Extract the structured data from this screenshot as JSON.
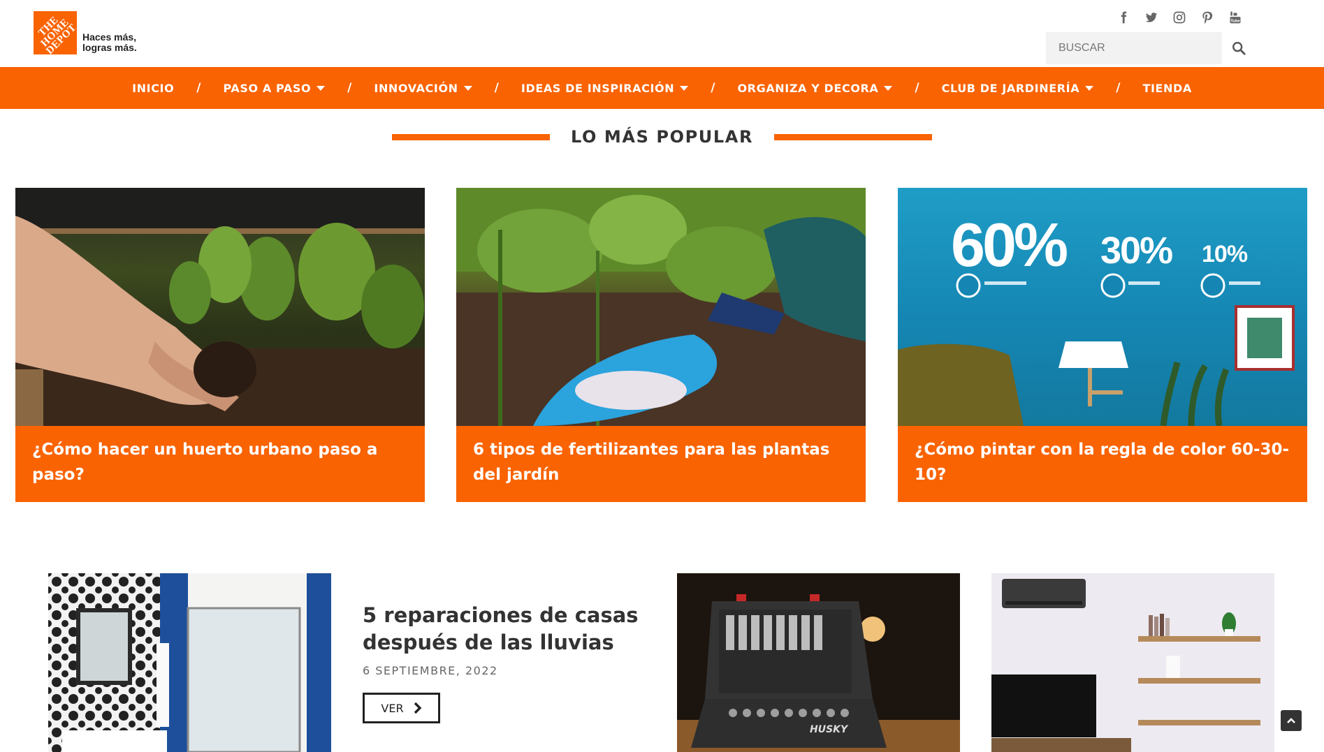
{
  "header": {
    "logo_text": "THE\nHOME\nDEPOT",
    "tagline_line1": "Haces más,",
    "tagline_line2": "logras más.",
    "social": [
      "facebook-icon",
      "twitter-icon",
      "instagram-icon",
      "pinterest-icon",
      "youtube-icon"
    ],
    "search_placeholder": "BUSCAR"
  },
  "nav": {
    "items": [
      {
        "label": "INICIO",
        "dropdown": false
      },
      {
        "label": "PASO A PASO",
        "dropdown": true
      },
      {
        "label": "INNOVACIÓN",
        "dropdown": true
      },
      {
        "label": "IDEAS DE INSPIRACIÓN",
        "dropdown": true
      },
      {
        "label": "ORGANIZA Y DECORA",
        "dropdown": true
      },
      {
        "label": "CLUB DE JARDINERÍA",
        "dropdown": true
      },
      {
        "label": "TIENDA",
        "dropdown": false
      }
    ],
    "separator": "/"
  },
  "popular": {
    "title": "LO MÁS POPULAR",
    "cards": [
      {
        "title": "¿Cómo hacer un huerto urbano paso a paso?"
      },
      {
        "title": "6 tipos de fertilizantes para las plantas del jardín"
      },
      {
        "title": "¿Cómo pintar con la regla de color 60-30-10?",
        "image_text": {
          "p60": "60%",
          "p30": "30%",
          "p10": "10%"
        }
      }
    ]
  },
  "featured": {
    "title": "5 reparaciones de casas después de las lluvias",
    "date": "6 SEPTIEMBRE, 2022",
    "button_label": "VER",
    "brand_text": "HUSKY"
  },
  "colors": {
    "brand_orange": "#f96302",
    "text_dark": "#333333"
  }
}
